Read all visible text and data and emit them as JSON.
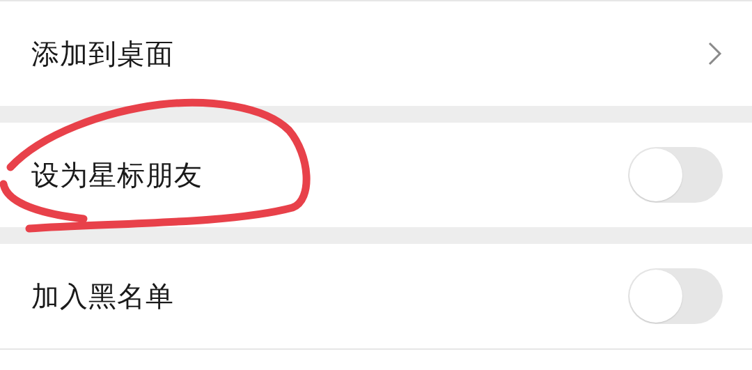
{
  "settings": [
    {
      "kind": "link",
      "label": "添加到桌面"
    },
    {
      "kind": "toggle",
      "label": "设为星标朋友",
      "on": false
    },
    {
      "kind": "toggle",
      "label": "加入黑名单",
      "on": false
    }
  ]
}
